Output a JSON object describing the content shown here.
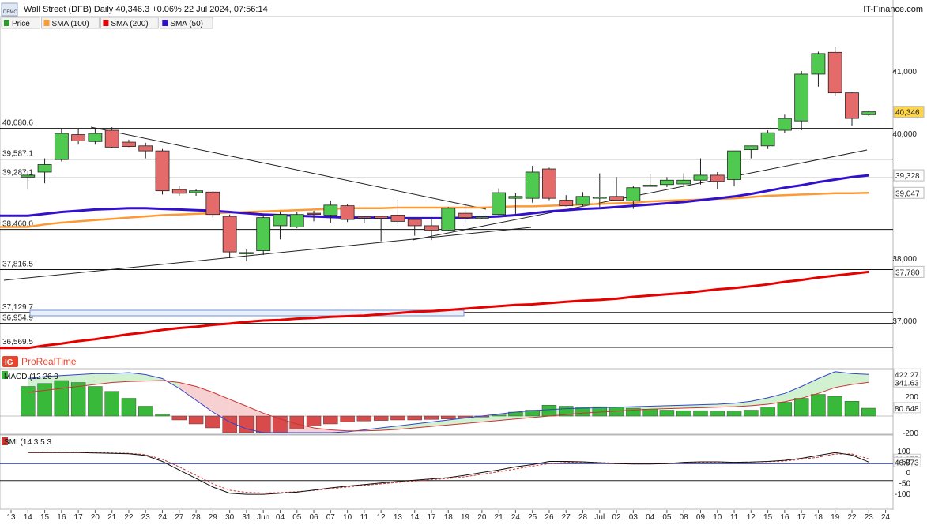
{
  "header": {
    "title": "Wall Street (DFB) Daily 40,346.3 +0.06% 22 Jul 2024, 07:56:14",
    "brand": "IT-Finance.com",
    "demo_badge": "DEMO",
    "logo_text": "ProRealTime",
    "logo_mark": "IG"
  },
  "legend": [
    {
      "label": "Price",
      "color": "#2e9b2e"
    },
    {
      "label": "SMA (100)",
      "color": "#ff9933"
    },
    {
      "label": "SMA (200)",
      "color": "#e60000"
    },
    {
      "label": "SMA (50)",
      "color": "#3311cc"
    }
  ],
  "price_axis": {
    "ticks": [
      "41,000",
      "40,000",
      "38,000",
      "37,000"
    ]
  },
  "levels": [
    "40,080.6",
    "39,587.1",
    "39,287.1",
    "38,460.0",
    "37,816.5",
    "37,129.7",
    "36,954.9",
    "36,569.5"
  ],
  "right_tags": [
    {
      "text": "40,346",
      "bg": "#ffd54a",
      "color": "#111",
      "value": 40346
    },
    {
      "text": "39,328",
      "bg": "#ffffff",
      "color": "#3311cc",
      "value": 39328
    },
    {
      "text": "39,047",
      "bg": "#ffffff",
      "color": "#ff9933",
      "value": 39047
    },
    {
      "text": "37,780",
      "bg": "#ffffff",
      "color": "#e60000",
      "value": 37780
    }
  ],
  "macd": {
    "label": "MACD (12 26 9",
    "tags": [
      {
        "text": "422.27",
        "color": "#3344cc",
        "value": 422
      },
      {
        "text": "341.63",
        "color": "#cc3333",
        "value": 342
      },
      {
        "text": "80.648",
        "color": "#1f8a1f",
        "value": 81
      }
    ],
    "ticks": [
      "200",
      "-200"
    ]
  },
  "smi": {
    "label": "SMI (14 3 5 3",
    "tags": [
      {
        "text": "61.975",
        "color": "#cc3333",
        "value": 62
      },
      {
        "text": "46.873",
        "color": "#111111",
        "value": 47
      }
    ],
    "ticks": [
      "100",
      "50",
      "0",
      "-50",
      "-100"
    ]
  },
  "x_axis": {
    "labels": [
      "13",
      "14",
      "15",
      "16",
      "17",
      "20",
      "21",
      "22",
      "23",
      "24",
      "27",
      "28",
      "29",
      "30",
      "31",
      "Jun",
      "04",
      "05",
      "06",
      "07",
      "10",
      "11",
      "12",
      "13",
      "14",
      "17",
      "18",
      "19",
      "20",
      "21",
      "24",
      "25",
      "26",
      "27",
      "28",
      "Jul",
      "02",
      "03",
      "04",
      "05",
      "08",
      "09",
      "10",
      "11",
      "12",
      "15",
      "16",
      "17",
      "18",
      "19",
      "22",
      "23",
      "24"
    ]
  },
  "chart_data": {
    "type": "candlestick",
    "title": "Wall Street (DFB) Daily",
    "price_ylim": [
      36500,
      41500
    ],
    "candles": [
      {
        "o": 39300,
        "h": 39400,
        "l": 39100,
        "c": 39330
      },
      {
        "o": 39380,
        "h": 39600,
        "l": 39200,
        "c": 39500
      },
      {
        "o": 39580,
        "h": 40080,
        "l": 39550,
        "c": 40000
      },
      {
        "o": 39980,
        "h": 40080,
        "l": 39820,
        "c": 39880
      },
      {
        "o": 39870,
        "h": 40080,
        "l": 39820,
        "c": 40000
      },
      {
        "o": 40050,
        "h": 40100,
        "l": 39760,
        "c": 39780
      },
      {
        "o": 39860,
        "h": 39900,
        "l": 39780,
        "c": 39790
      },
      {
        "o": 39800,
        "h": 39850,
        "l": 39600,
        "c": 39720
      },
      {
        "o": 39720,
        "h": 39750,
        "l": 39020,
        "c": 39080
      },
      {
        "o": 39100,
        "h": 39160,
        "l": 39000,
        "c": 39040
      },
      {
        "o": 39050,
        "h": 39100,
        "l": 39000,
        "c": 39080
      },
      {
        "o": 39060,
        "h": 39070,
        "l": 38650,
        "c": 38700
      },
      {
        "o": 38670,
        "h": 38700,
        "l": 38000,
        "c": 38100
      },
      {
        "o": 38080,
        "h": 38140,
        "l": 37950,
        "c": 38090
      },
      {
        "o": 38120,
        "h": 38700,
        "l": 38050,
        "c": 38650
      },
      {
        "o": 38520,
        "h": 38750,
        "l": 38300,
        "c": 38700
      },
      {
        "o": 38500,
        "h": 38740,
        "l": 38480,
        "c": 38700
      },
      {
        "o": 38720,
        "h": 38760,
        "l": 38590,
        "c": 38710
      },
      {
        "o": 38690,
        "h": 38920,
        "l": 38570,
        "c": 38850
      },
      {
        "o": 38840,
        "h": 38860,
        "l": 38580,
        "c": 38620
      },
      {
        "o": 38660,
        "h": 38680,
        "l": 38560,
        "c": 38640
      },
      {
        "o": 38670,
        "h": 38680,
        "l": 38270,
        "c": 38640
      },
      {
        "o": 38690,
        "h": 38940,
        "l": 38520,
        "c": 38590
      },
      {
        "o": 38620,
        "h": 38630,
        "l": 38360,
        "c": 38520
      },
      {
        "o": 38520,
        "h": 38630,
        "l": 38290,
        "c": 38450
      },
      {
        "o": 38450,
        "h": 38820,
        "l": 38440,
        "c": 38800
      },
      {
        "o": 38720,
        "h": 38850,
        "l": 38570,
        "c": 38650
      },
      {
        "o": 38660,
        "h": 38680,
        "l": 38620,
        "c": 38660
      },
      {
        "o": 38700,
        "h": 39120,
        "l": 38680,
        "c": 39050
      },
      {
        "o": 38960,
        "h": 39040,
        "l": 38690,
        "c": 38990
      },
      {
        "o": 38960,
        "h": 39480,
        "l": 38890,
        "c": 39380
      },
      {
        "o": 39430,
        "h": 39450,
        "l": 38930,
        "c": 38960
      },
      {
        "o": 38930,
        "h": 39010,
        "l": 38830,
        "c": 38840
      },
      {
        "o": 38860,
        "h": 39060,
        "l": 38830,
        "c": 38990
      },
      {
        "o": 38970,
        "h": 39360,
        "l": 38820,
        "c": 38980
      },
      {
        "o": 38990,
        "h": 39300,
        "l": 38930,
        "c": 38930
      },
      {
        "o": 38920,
        "h": 39160,
        "l": 38790,
        "c": 39130
      },
      {
        "o": 39160,
        "h": 39350,
        "l": 39150,
        "c": 39170
      },
      {
        "o": 39180,
        "h": 39300,
        "l": 39140,
        "c": 39250
      },
      {
        "o": 39190,
        "h": 39360,
        "l": 39160,
        "c": 39250
      },
      {
        "o": 39250,
        "h": 39600,
        "l": 39180,
        "c": 39330
      },
      {
        "o": 39330,
        "h": 39380,
        "l": 39100,
        "c": 39230
      },
      {
        "o": 39260,
        "h": 39700,
        "l": 39150,
        "c": 39720
      },
      {
        "o": 39740,
        "h": 39800,
        "l": 39600,
        "c": 39800
      },
      {
        "o": 39800,
        "h": 40050,
        "l": 39750,
        "c": 40010
      },
      {
        "o": 40050,
        "h": 40300,
        "l": 40000,
        "c": 40240
      },
      {
        "o": 40200,
        "h": 41000,
        "l": 40050,
        "c": 40950
      },
      {
        "o": 40950,
        "h": 41310,
        "l": 40750,
        "c": 41280
      },
      {
        "o": 41300,
        "h": 41380,
        "l": 40600,
        "c": 40650
      },
      {
        "o": 40650,
        "h": 40660,
        "l": 40120,
        "c": 40240
      },
      {
        "o": 40300,
        "h": 40370,
        "l": 40280,
        "c": 40346
      }
    ],
    "sma100": [
      38500,
      38540,
      38570,
      38590,
      38610,
      38630,
      38650,
      38670,
      38690,
      38700,
      38710,
      38720,
      38730,
      38740,
      38750,
      38760,
      38770,
      38780,
      38790,
      38800,
      38800,
      38800,
      38810,
      38810,
      38810,
      38810,
      38810,
      38810,
      38820,
      38830,
      38830,
      38840,
      38850,
      38860,
      38870,
      38880,
      38890,
      38910,
      38920,
      38930,
      38940,
      38950,
      38960,
      38980,
      39000,
      39010,
      39020,
      39030,
      39040,
      39040,
      39047
    ],
    "sma200": [
      36560,
      36600,
      36630,
      36670,
      36700,
      36740,
      36780,
      36810,
      36850,
      36880,
      36900,
      36930,
      36950,
      36980,
      37000,
      37010,
      37030,
      37040,
      37060,
      37070,
      37080,
      37100,
      37120,
      37140,
      37150,
      37170,
      37190,
      37210,
      37230,
      37250,
      37260,
      37280,
      37300,
      37320,
      37330,
      37350,
      37380,
      37400,
      37420,
      37440,
      37470,
      37500,
      37520,
      37550,
      37580,
      37620,
      37650,
      37690,
      37720,
      37750,
      37780
    ],
    "sma50": [
      38680,
      38710,
      38740,
      38760,
      38780,
      38790,
      38800,
      38800,
      38790,
      38780,
      38770,
      38760,
      38740,
      38720,
      38700,
      38690,
      38680,
      38670,
      38660,
      38650,
      38650,
      38650,
      38640,
      38640,
      38640,
      38640,
      38650,
      38660,
      38670,
      38690,
      38720,
      38750,
      38770,
      38790,
      38800,
      38820,
      38840,
      38860,
      38880,
      38900,
      38930,
      38960,
      38990,
      39030,
      39080,
      39130,
      39170,
      39220,
      39260,
      39300,
      39328
    ],
    "macd": {
      "histogram": [
        300,
        330,
        360,
        340,
        300,
        250,
        180,
        100,
        20,
        -40,
        -80,
        -120,
        -170,
        -220,
        -210,
        -170,
        -130,
        -100,
        -80,
        -60,
        -50,
        -45,
        -40,
        -40,
        -35,
        -30,
        -20,
        -10,
        10,
        40,
        60,
        110,
        100,
        90,
        95,
        90,
        80,
        70,
        60,
        55,
        55,
        50,
        50,
        60,
        90,
        140,
        180,
        220,
        200,
        150,
        80
      ],
      "macd_line": [
        380,
        400,
        410,
        420,
        430,
        430,
        440,
        420,
        380,
        280,
        160,
        40,
        -60,
        -130,
        -170,
        -190,
        -200,
        -195,
        -180,
        -160,
        -140,
        -120,
        -100,
        -80,
        -60,
        -40,
        -20,
        0,
        20,
        40,
        55,
        65,
        75,
        80,
        85,
        90,
        95,
        100,
        105,
        110,
        115,
        120,
        130,
        150,
        185,
        230,
        300,
        380,
        450,
        430,
        422
      ],
      "signal_line": [
        240,
        260,
        280,
        300,
        320,
        340,
        350,
        355,
        360,
        340,
        300,
        240,
        170,
        100,
        30,
        -30,
        -80,
        -120,
        -140,
        -150,
        -150,
        -145,
        -135,
        -120,
        -105,
        -90,
        -75,
        -60,
        -45,
        -30,
        -15,
        0,
        15,
        30,
        40,
        50,
        60,
        70,
        75,
        80,
        85,
        90,
        95,
        105,
        120,
        145,
        180,
        230,
        290,
        320,
        341.63
      ]
    },
    "smi_series": {
      "smi": [
        92,
        92,
        92,
        92,
        90,
        88,
        86,
        78,
        50,
        10,
        -30,
        -70,
        -99,
        -104,
        -104,
        -99,
        -94,
        -84,
        -74,
        -66,
        -58,
        -51,
        -44,
        -38,
        -32,
        -26,
        -15,
        -2,
        10,
        25,
        35,
        50,
        50,
        48,
        44,
        40,
        38,
        38,
        40,
        46,
        48,
        48,
        46,
        47,
        50,
        55,
        65,
        78,
        92,
        80,
        46.873
      ],
      "signal": [
        94,
        94,
        94,
        94,
        92,
        90,
        88,
        82,
        60,
        25,
        -15,
        -55,
        -85,
        -95,
        -98,
        -96,
        -92,
        -86,
        -78,
        -70,
        -62,
        -55,
        -48,
        -42,
        -36,
        -30,
        -22,
        -10,
        2,
        15,
        28,
        40,
        46,
        47,
        45,
        42,
        40,
        40,
        41,
        44,
        46,
        47,
        46,
        47,
        49,
        52,
        60,
        70,
        85,
        85,
        61.975
      ]
    }
  }
}
